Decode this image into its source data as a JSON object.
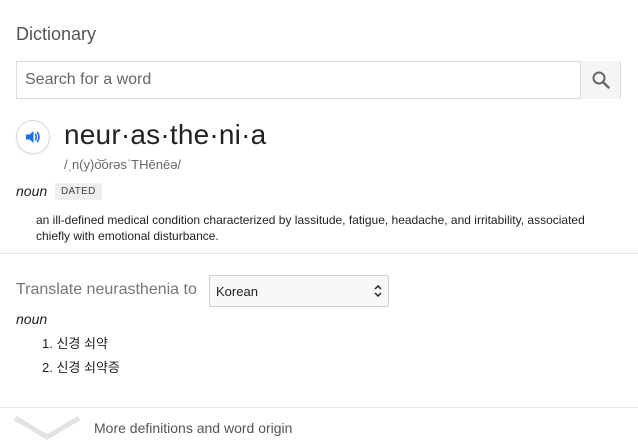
{
  "dictionary": {
    "title": "Dictionary",
    "search": {
      "placeholder": "Search for a word"
    },
    "entry": {
      "word": "neur·as·the·ni·a",
      "phonetic": "/ˌn(y)o͝orəsˈTHēnēə/",
      "sense": {
        "part_of_speech": "noun",
        "badge": "DATED",
        "definition": "an ill-defined medical condition characterized by lassitude, fatigue, headache, and irritability, associated chiefly with emotional disturbance."
      }
    },
    "translate": {
      "label": "Translate neurasthenia to",
      "language": "Korean",
      "part_of_speech": "noun",
      "items": [
        "1. 신경 쇠약",
        "2. 신경 쇠약증"
      ]
    },
    "more_label": "More definitions and word origin"
  },
  "colors": {
    "accent": "#1a73e8",
    "text": "#222222",
    "muted": "#777777"
  },
  "icons": {
    "search": "search-icon",
    "speaker": "speaker-icon",
    "chevron": "chevron-down-icon"
  }
}
